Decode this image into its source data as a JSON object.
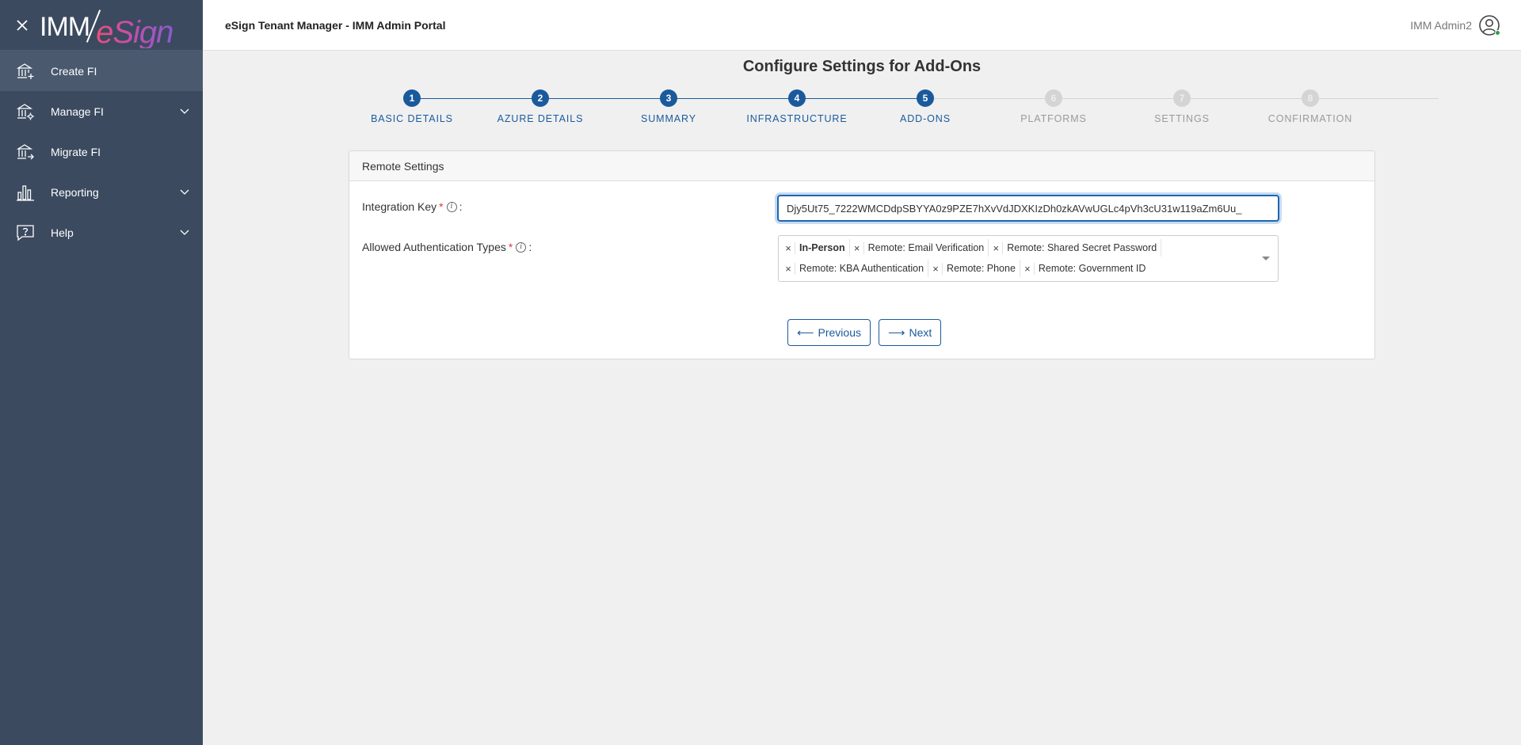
{
  "sidebar": {
    "logo_left": "IMM",
    "logo_right": "eSign",
    "items": [
      {
        "label": "Create FI",
        "icon": "bank-plus-icon",
        "active": true,
        "has_children": false
      },
      {
        "label": "Manage FI",
        "icon": "bank-gear-icon",
        "active": false,
        "has_children": true
      },
      {
        "label": "Migrate FI",
        "icon": "bank-arrow-icon",
        "active": false,
        "has_children": false
      },
      {
        "label": "Reporting",
        "icon": "bar-chart-icon",
        "active": false,
        "has_children": true
      },
      {
        "label": "Help",
        "icon": "help-chat-icon",
        "active": false,
        "has_children": true
      }
    ]
  },
  "header": {
    "title": "eSign Tenant Manager - IMM Admin Portal",
    "user_name": "IMM Admin2",
    "user_status_color": "#2ca24a"
  },
  "page": {
    "title": "Configure Settings for Add-Ons"
  },
  "stepper": {
    "current_step": 5,
    "steps": [
      {
        "number": "1",
        "label": "BASIC DETAILS",
        "state": "done"
      },
      {
        "number": "2",
        "label": "AZURE DETAILS",
        "state": "done"
      },
      {
        "number": "3",
        "label": "SUMMARY",
        "state": "done"
      },
      {
        "number": "4",
        "label": "INFRASTRUCTURE",
        "state": "done"
      },
      {
        "number": "5",
        "label": "ADD-ONS",
        "state": "current"
      },
      {
        "number": "6",
        "label": "PLATFORMS",
        "state": "todo"
      },
      {
        "number": "7",
        "label": "SETTINGS",
        "state": "todo"
      },
      {
        "number": "8",
        "label": "CONFIRMATION",
        "state": "todo"
      }
    ]
  },
  "form": {
    "section_title": "Remote Settings",
    "integration_key": {
      "label": "Integration Key",
      "required_mark": "*",
      "colon": ":",
      "value": "Djy5Ut75_7222WMCDdpSBYYA0z9PZE7hXvVdJDXKIzDh0zkAVwUGLc4pVh3cU31w119aZm6Uu_"
    },
    "auth_types": {
      "label": "Allowed Authentication Types",
      "required_mark": "*",
      "colon": ":",
      "selected": [
        {
          "label": "In-Person",
          "bold": true
        },
        {
          "label": "Remote: Email Verification",
          "bold": false
        },
        {
          "label": "Remote: Shared Secret Password",
          "bold": false
        },
        {
          "label": "Remote: KBA Authentication",
          "bold": false
        },
        {
          "label": "Remote: Phone",
          "bold": false
        },
        {
          "label": "Remote: Government ID",
          "bold": false
        }
      ]
    },
    "remove_glyph": "×",
    "info_glyph": "i"
  },
  "actions": {
    "previous_label": "Previous",
    "previous_arrow": "⟵",
    "next_label": "Next",
    "next_arrow": "⟶"
  },
  "colors": {
    "sidebar_bg": "#3b4a5f",
    "primary": "#1a5a9c",
    "stepper_inactive": "#d4d4d4",
    "required": "#d9363e"
  }
}
